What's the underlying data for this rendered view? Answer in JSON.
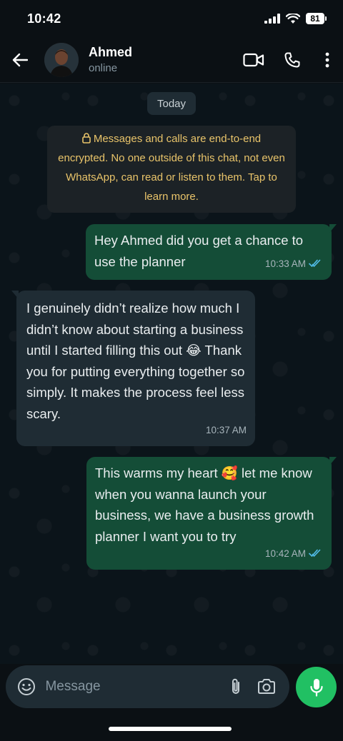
{
  "status_bar": {
    "time": "10:42",
    "battery": "81"
  },
  "header": {
    "contact_name": "Ahmed",
    "presence": "online"
  },
  "chat": {
    "date_chip": "Today",
    "encryption_notice": "Messages and calls are end-to-end encrypted. No one outside of this chat, not even WhatsApp, can read or listen to them. Tap to learn more.",
    "messages": [
      {
        "direction": "out",
        "text": "Hey Ahmed  did you get a chance to use the planner",
        "time": "10:33 AM",
        "status": "read"
      },
      {
        "direction": "in",
        "text": "I genuinely didn’t realize how much I didn’t know about starting a business until I started filling this out 😂 Thank you for putting everything together so simply. It makes the process feel less scary.",
        "time": "10:37 AM"
      },
      {
        "direction": "out",
        "text": "This warms my heart 🥰 let me know when you wanna launch your business, we have a business growth planner I want you to try",
        "time": "10:42 AM",
        "status": "read"
      }
    ]
  },
  "composer": {
    "placeholder": "Message"
  },
  "colors": {
    "accent": "#21c063",
    "outgoing_bubble": "#144d37",
    "incoming_bubble": "#1f2c34",
    "read_ticks": "#53bdeb",
    "notice_text": "#e9c46a"
  },
  "icons": [
    "back-arrow-icon",
    "video-call-icon",
    "phone-icon",
    "more-vert-icon",
    "lock-icon",
    "double-check-icon",
    "emoji-icon",
    "attach-icon",
    "camera-icon",
    "mic-icon",
    "signal-icon",
    "wifi-icon"
  ]
}
